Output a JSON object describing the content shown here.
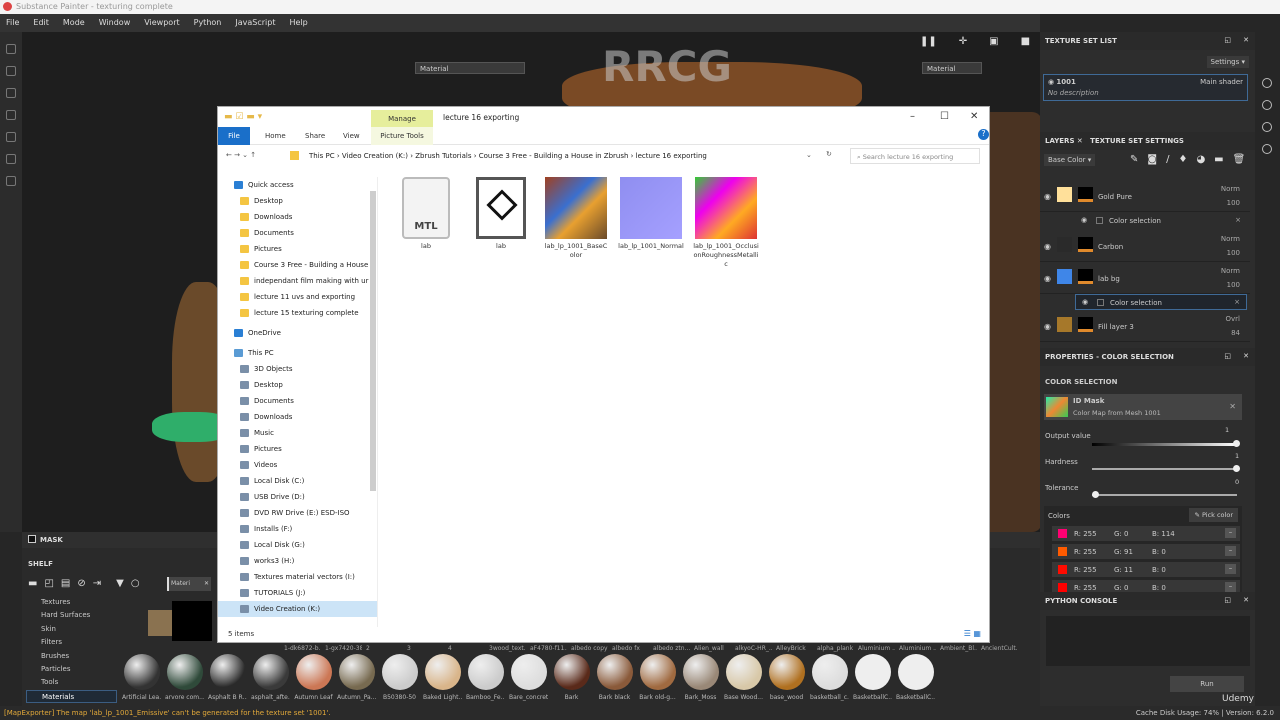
{
  "app": {
    "title": "Substance Painter - texturing complete",
    "menu": [
      "File",
      "Edit",
      "Mode",
      "Window",
      "Viewport",
      "Python",
      "JavaScript",
      "Help"
    ],
    "watermark": "RRCG"
  },
  "viewport": {
    "left_mode": "Material",
    "right_mode": "Material"
  },
  "mask": {
    "label": "MASK"
  },
  "shelf": {
    "title": "SHELF",
    "search": "Materi",
    "categories": [
      "Textures",
      "Hard Surfaces",
      "Skin",
      "Filters",
      "Brushes",
      "Particles",
      "Tools",
      "Materials"
    ],
    "selected": "Materials",
    "top_labels": [
      "1-dk6872-b...",
      "1-gx7420-38",
      "2",
      "3",
      "4",
      "3wood_text...",
      "aF4780-f11...",
      "albedo copy",
      "albedo fx",
      "albedo ztn...",
      "Alien_wall",
      "alkyoC-HR_...",
      "AlleyBrick",
      "alpha_plank",
      "Aluminium ...",
      "Aluminium ...",
      "Ambient_Bl...",
      "AncientCult..."
    ],
    "materials": [
      "Artificial Lea...",
      "arvore com...",
      "Asphalt B R...",
      "asphalt_afte...",
      "Autumn Leaf",
      "Autumn_Pa...",
      "B50380-50",
      "Baked Light...",
      "Bamboo_Fe...",
      "Bare_concrete",
      "Bark",
      "Bark black",
      "Bark old-g...",
      "Bark_Moss",
      "Base Wood...",
      "base_wood",
      "basketball_c...",
      "BasketballC...",
      "BasketballC..."
    ]
  },
  "status": {
    "message": "[MapExporter] The map 'lab_lp_1001_Emissive' can't be generated for the texture set '1001'.",
    "cache": "Cache Disk Usage:  74% | Version: 6.2.0",
    "brand": "Udemy"
  },
  "texture_set_list": {
    "title": "TEXTURE SET LIST",
    "settings": "Settings",
    "set_name": "1001",
    "shader": "Main shader",
    "description": "No description"
  },
  "layers": {
    "tab": "LAYERS",
    "tab2": "TEXTURE SET SETTINGS",
    "channel": "Base Color",
    "items": [
      {
        "name": "Gold Pure",
        "blend": "Norm",
        "opacity": "100",
        "color": "#ffe09a"
      },
      {
        "name": "Carbon",
        "blend": "Norm",
        "opacity": "100",
        "color": "#2a2a2a"
      },
      {
        "name": "lab bg",
        "blend": "Norm",
        "opacity": "100",
        "color": "#3f86e8"
      },
      {
        "name": "Fill layer 3",
        "blend": "Ovrl",
        "opacity": "84",
        "color": "#a6782a"
      }
    ],
    "sub_label": "Color selection"
  },
  "properties": {
    "title": "PROPERTIES - COLOR SELECTION",
    "section": "COLOR SELECTION",
    "mask_title": "ID Mask",
    "mask_sub": "Color Map from Mesh 1001",
    "output_label": "Output value",
    "output_value": "1",
    "hardness_label": "Hardness",
    "hardness_value": "1",
    "tolerance_label": "Tolerance",
    "tolerance_value": "0",
    "colors_label": "Colors",
    "pick": "Pick color",
    "colors": [
      {
        "r": "R: 255",
        "g": "G: 0",
        "b": "B: 114",
        "hex": "#ff0072"
      },
      {
        "r": "R: 255",
        "g": "G: 91",
        "b": "B: 0",
        "hex": "#ff5b00"
      },
      {
        "r": "R: 255",
        "g": "G: 11",
        "b": "B: 0",
        "hex": "#ff0b00"
      },
      {
        "r": "R: 255",
        "g": "G: 0",
        "b": "B: 0",
        "hex": "#ff0000"
      }
    ]
  },
  "python": {
    "title": "PYTHON CONSOLE",
    "run": "Run"
  },
  "explorer": {
    "manage": "Manage",
    "title": "lecture 16 exporting",
    "tabs": [
      "File",
      "Home",
      "Share",
      "View",
      "Picture Tools"
    ],
    "crumbs": "This PC  ›  Video Creation (K:)  ›  Zbrush Tutorials  ›  Course 3 Free - Building a House in Zbrush  ›  lecture 16 exporting",
    "search_placeholder": "Search lecture 16 exporting",
    "nav": [
      "Quick access",
      "Desktop",
      "Downloads",
      "Documents",
      "Pictures",
      "Course 3 Free - Building a House",
      "independant film making with ur",
      "lecture 11 uvs and exporting",
      "lecture 15 texturing complete",
      "OneDrive",
      "This PC",
      "3D Objects",
      "Desktop",
      "Documents",
      "Downloads",
      "Music",
      "Pictures",
      "Videos",
      "Local Disk (C:)",
      "USB Drive (D:)",
      "DVD RW Drive (E:) ESD-ISO",
      "Installs (F:)",
      "Local Disk (G:)",
      "works3 (H:)",
      "Textures material vectors (I:)",
      "TUTORIALS (J:)",
      "Video Creation (K:)"
    ],
    "files": [
      {
        "name": "lab",
        "type": "MTL"
      },
      {
        "name": "lab",
        "type": "obj"
      },
      {
        "name": "lab_lp_1001_BaseColor"
      },
      {
        "name": "lab_lp_1001_Normal"
      },
      {
        "name": "lab_lp_1001_OcclusionRoughnessMetallic"
      }
    ],
    "count": "5 items"
  }
}
